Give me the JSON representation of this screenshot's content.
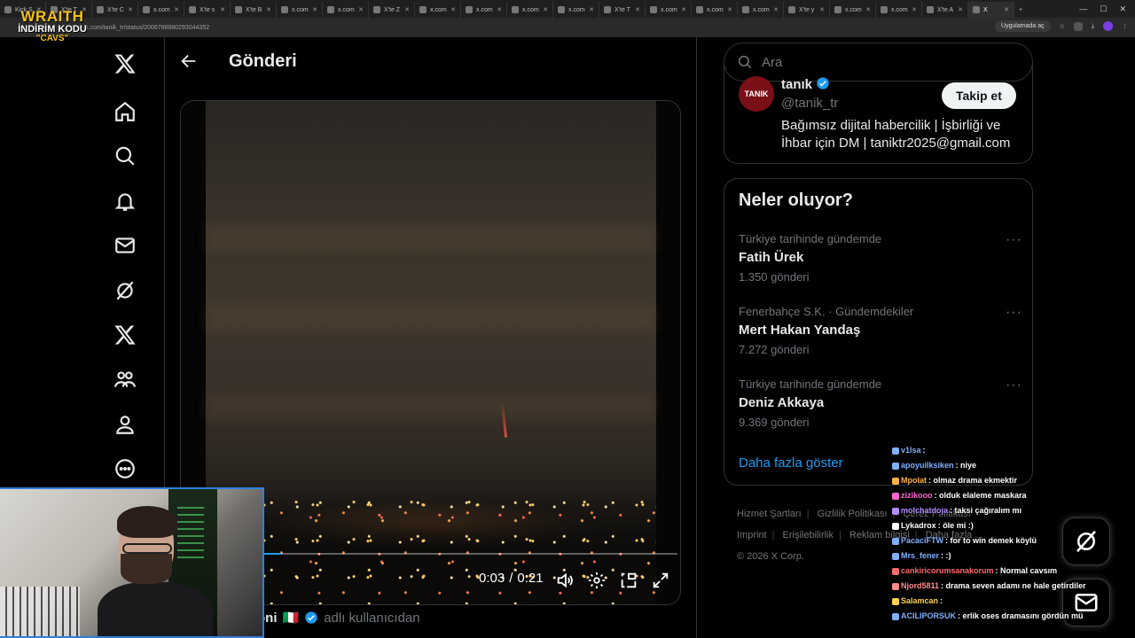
{
  "browser": {
    "tabs": [
      {
        "label": "Kick.S"
      },
      {
        "label": "X'te T"
      },
      {
        "label": "X'te C"
      },
      {
        "label": "x.com"
      },
      {
        "label": "X'te s"
      },
      {
        "label": "X'te B"
      },
      {
        "label": "x.com"
      },
      {
        "label": "x.com"
      },
      {
        "label": "X'te Z"
      },
      {
        "label": "x.com"
      },
      {
        "label": "x.com"
      },
      {
        "label": "x.com"
      },
      {
        "label": "x.com"
      },
      {
        "label": "X'te T"
      },
      {
        "label": "x.com"
      },
      {
        "label": "x.com"
      },
      {
        "label": "x.com"
      },
      {
        "label": "X'te y"
      },
      {
        "label": "x.com"
      },
      {
        "label": "x.com"
      },
      {
        "label": "X'te A"
      },
      {
        "label": "X"
      }
    ],
    "url": "x.com/tanik_tr/status/2006786680293044352",
    "app_pill": "Uygulamada aç"
  },
  "overlay_logo": {
    "line1": "WRAITH",
    "line2": "İNDİRİM KODU",
    "line3": "\"CAVS\""
  },
  "header": {
    "title": "Gönderi"
  },
  "video": {
    "current_time": "0:03",
    "separator": "/",
    "duration": "0:21",
    "progress": 0.14
  },
  "post_author": {
    "name": "oni",
    "flag": "🇮🇹",
    "suffix": "adlı kullanıcıdan"
  },
  "search": {
    "placeholder": "Ara"
  },
  "profile": {
    "avatar_text": "TANIK",
    "name": "tanık",
    "handle": "@tanik_tr",
    "follow_label": "Takip et",
    "bio": "Bağımsız dijital habercilik | İşbirliği ve İhbar için DM | taniktr2025@gmail.com"
  },
  "trends": {
    "heading": "Neler oluyor?",
    "items": [
      {
        "context": "Türkiye tarihinde gündemde",
        "title": "Fatih Ürek",
        "count": "1.350 gönderi"
      },
      {
        "context": "Fenerbahçe S.K. · Gündemdekiler",
        "title": "Mert Hakan Yandaş",
        "count": "7.272 gönderi"
      },
      {
        "context": "Türkiye tarihinde gündemde",
        "title": "Deniz Akkaya",
        "count": "9.369 gönderi"
      }
    ],
    "show_more": "Daha fazla göster"
  },
  "footer": {
    "links": [
      "Hizmet Şartları",
      "Gizlilik Politikası",
      "Çerez Politikası",
      "Imprint",
      "Erişilebilirlik",
      "Reklam bilgisi",
      "Daha fazla ..."
    ],
    "copyright": "© 2026 X Corp."
  },
  "chat": [
    {
      "user": "v1lsa",
      "color": "#7fb0ff",
      "message": ""
    },
    {
      "user": "apoyuilksiken",
      "color": "#7fb0ff",
      "message": "niye"
    },
    {
      "user": "Mpolat",
      "color": "#ffb347",
      "message": "olmaz drama ekmektir"
    },
    {
      "user": "zizikooo",
      "color": "#ff66cc",
      "message": "olduk elaleme maskara"
    },
    {
      "user": "molchatdoja",
      "color": "#b38cff",
      "message": "taksi çağıralım mı"
    },
    {
      "user": "Lykadrox",
      "color": "#ffffff",
      "message": "öle mi :)"
    },
    {
      "user": "PacaciFTW",
      "color": "#7fb0ff",
      "message": "for to win demek köylü"
    },
    {
      "user": "Mrs_fener",
      "color": "#7fb0ff",
      "message": ":)"
    },
    {
      "user": "cankiricorumsanakorum",
      "color": "#ff6b6b",
      "message": "Normal cavsım"
    },
    {
      "user": "Njord5811",
      "color": "#ff8a8a",
      "message": "drama seven adamı ne hale getirdiler"
    },
    {
      "user": "Salamcan",
      "color": "#ffd24d",
      "message": ""
    },
    {
      "user": "ACILIPORSUK",
      "color": "#7fb0ff",
      "message": "erlik oses dramasını gördün mü"
    }
  ],
  "colors": {
    "accent": "#1d9bf0",
    "border": "#2f3336",
    "muted": "#71767b",
    "webcam_border": "#2f7fe0"
  }
}
